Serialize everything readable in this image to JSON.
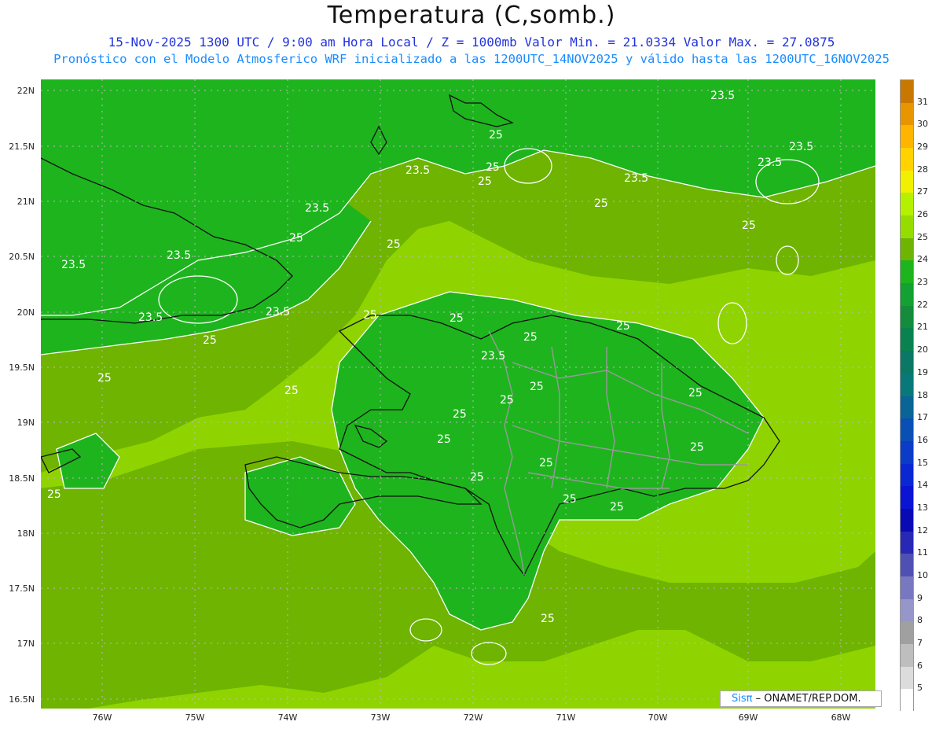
{
  "title": "Temperatura (C,somb.)",
  "subtitle_1": "15-Nov-2025  1300 UTC / 9:00 am Hora Local / Z = 1000mb   Valor Min. = 21.0334  Valor Max. = 27.0875",
  "subtitle_2": "Pronóstico con el Modelo Atmosferico WRF inicializado a las 1200UTC_14NOV2025 y válido hasta las  1200UTC_16NOV2025",
  "latitude_labels": [
    "22N",
    "21.5N",
    "21N",
    "20.5N",
    "20N",
    "19.5N",
    "19N",
    "18.5N",
    "18N",
    "17.5N",
    "17N",
    "16.5N"
  ],
  "longitude_labels": [
    "76W",
    "75W",
    "74W",
    "73W",
    "72W",
    "71W",
    "70W",
    "69W",
    "68W"
  ],
  "colorbar": {
    "levels": [
      "31",
      "30",
      "29",
      "28",
      "27",
      "26",
      "25",
      "24",
      "23",
      "22",
      "21",
      "20",
      "19",
      "18",
      "17",
      "16",
      "15",
      "14",
      "13",
      "12",
      "11",
      "10",
      "9",
      "8",
      "7",
      "6",
      "5"
    ],
    "colors": [
      "#c87800",
      "#e89600",
      "#ffb400",
      "#ffd200",
      "#f0f000",
      "#b4f000",
      "#96dc00",
      "#6eb400",
      "#1eb41e",
      "#14a032",
      "#148c3c",
      "#0a8250",
      "#0a7864",
      "#087878",
      "#0a6496",
      "#0a50b4",
      "#0a3cc8",
      "#0a28d2",
      "#0a14d2",
      "#0a0ab4",
      "#2828b4",
      "#5050b4",
      "#7878c0",
      "#9696c8",
      "#a0a0a0",
      "#bebebe",
      "#dcdcdc",
      "#ffffff"
    ]
  },
  "map": {
    "fill_colors": {
      "below_23_5": "#1eb41e",
      "range_23_5_25": "#6eb400",
      "above_25": "#8fd400",
      "warm_26": "#96dc00"
    },
    "contour_color": "#ffffff",
    "contour_labels": [
      "23.5",
      "23.5",
      "23.5",
      "23.5",
      "23.5",
      "23.5",
      "23.5",
      "23.5",
      "23.5",
      "23.5",
      "23.5",
      "25",
      "25",
      "25",
      "25",
      "25",
      "25",
      "25",
      "25",
      "25",
      "25",
      "25",
      "25",
      "25",
      "25",
      "25",
      "25",
      "25",
      "25",
      "25",
      "25",
      "25",
      "25",
      "25",
      "25",
      "25",
      "25"
    ]
  },
  "credit": {
    "brand": "Sisπ",
    "org": " – ONAMET/REP.DOM."
  }
}
